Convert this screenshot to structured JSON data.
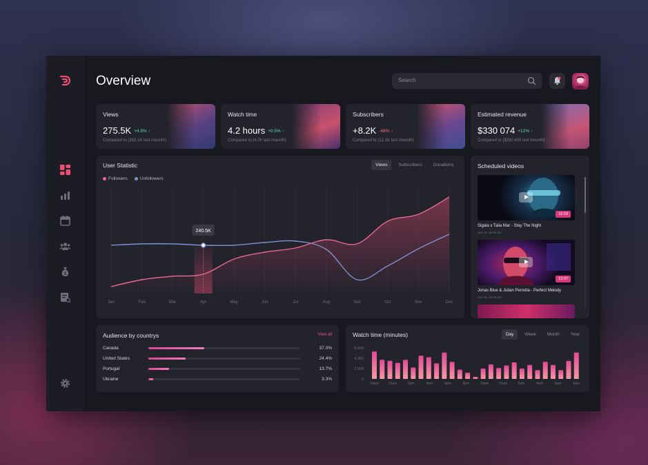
{
  "header": {
    "title": "Overview",
    "search_placeholder": "Search"
  },
  "sidebar": {
    "items": [
      "logo-icon",
      "dashboard-icon",
      "analytics-icon",
      "calendar-icon",
      "users-icon",
      "money-bag-icon",
      "reports-icon",
      "settings-icon"
    ]
  },
  "stats": [
    {
      "label": "Views",
      "value": "275.5K",
      "delta": "+4.5% ↑",
      "trend": "up",
      "compare": "Compared to (263.1K last mounth)"
    },
    {
      "label": "Watch time",
      "value": "4.2 hours",
      "delta": "+0.5% ↑",
      "trend": "up",
      "compare": "Compared to (4.0h last mounth)"
    },
    {
      "label": "Subscribers",
      "value": "+8.2K",
      "delta": "-48% ↓",
      "trend": "down",
      "compare": "Compared to (12.1K last mounth)"
    },
    {
      "label": "Estimated revenue",
      "value": "$330 074",
      "delta": "+12% ↑",
      "trend": "up",
      "compare": "Compared to ($290 400 last mounth)"
    }
  ],
  "user_statistic": {
    "title": "User Statistic",
    "tabs": [
      "Views",
      "Subscribers",
      "Donations"
    ],
    "active_tab": "Views",
    "tooltip": "240.5K",
    "legend": {
      "followers": "Followers",
      "unfollowers": "Unfollowers"
    }
  },
  "scheduled": {
    "title": "Scheduled videos",
    "videos": [
      {
        "title": "Sigala x Talia Mar - Stay The Night",
        "date": "Jun 12, 10:30 am",
        "duration": "15:03"
      },
      {
        "title": "Jonas Blue & Julian Perretta - Perfect Melody",
        "date": "Jun 16, 10:30 am",
        "duration": "13:37"
      }
    ]
  },
  "audience": {
    "title": "Audience by countrys",
    "view_all": "View all",
    "rows": [
      {
        "country": "Canada",
        "pct": "37.0%",
        "value": 37.0
      },
      {
        "country": "United States",
        "pct": "24.4%",
        "value": 24.4
      },
      {
        "country": "Portugal",
        "pct": "13.7%",
        "value": 13.7
      },
      {
        "country": "Ukraine",
        "pct": "3.3%",
        "value": 3.3
      }
    ]
  },
  "watch_time": {
    "title": "Watch time (minutes)",
    "tabs": [
      "Day",
      "Week",
      "Month",
      "Year"
    ],
    "active_tab": "Day"
  },
  "colors": {
    "accent": "#e95a80",
    "followers": "#ea6a92",
    "unfollowers": "#8090d0",
    "up": "#5ee0a8",
    "down": "#ff6b8a"
  },
  "chart_data": [
    {
      "type": "line",
      "title": "User Statistic",
      "x": [
        "Jan",
        "Feb",
        "Mar",
        "Apr",
        "May",
        "Jun",
        "Jul",
        "Aug",
        "Sep",
        "Oct",
        "Nov",
        "Dec"
      ],
      "series": [
        {
          "name": "Followers",
          "values": [
            10,
            20,
            25,
            28,
            50,
            60,
            66,
            78,
            72,
            105,
            115,
            140
          ]
        },
        {
          "name": "Unfollowers",
          "values": [
            70,
            72,
            72,
            70,
            70,
            74,
            76,
            64,
            20,
            40,
            65,
            86
          ]
        }
      ],
      "annotation": "240.5K",
      "grid": true,
      "legend": "top-left"
    },
    {
      "type": "bar",
      "title": "Watch time (minutes)",
      "y_ticks": [
        "6,000",
        "4,000",
        "2,000",
        "0"
      ],
      "ylim": [
        0,
        6000
      ],
      "x_tick_labels": [
        "10am",
        "12am",
        "2pm",
        "4pm",
        "6pm",
        "8pm",
        "10pm",
        "12pm",
        "2am",
        "4am",
        "6am",
        "8am"
      ],
      "values": [
        5300,
        3700,
        3500,
        3100,
        3700,
        2200,
        4500,
        4200,
        3000,
        5100,
        3300,
        1800,
        1200,
        400,
        2000,
        2800,
        2100,
        2600,
        3200,
        2000,
        2700,
        1700,
        3300,
        2700,
        1700,
        3500,
        5100
      ]
    }
  ]
}
